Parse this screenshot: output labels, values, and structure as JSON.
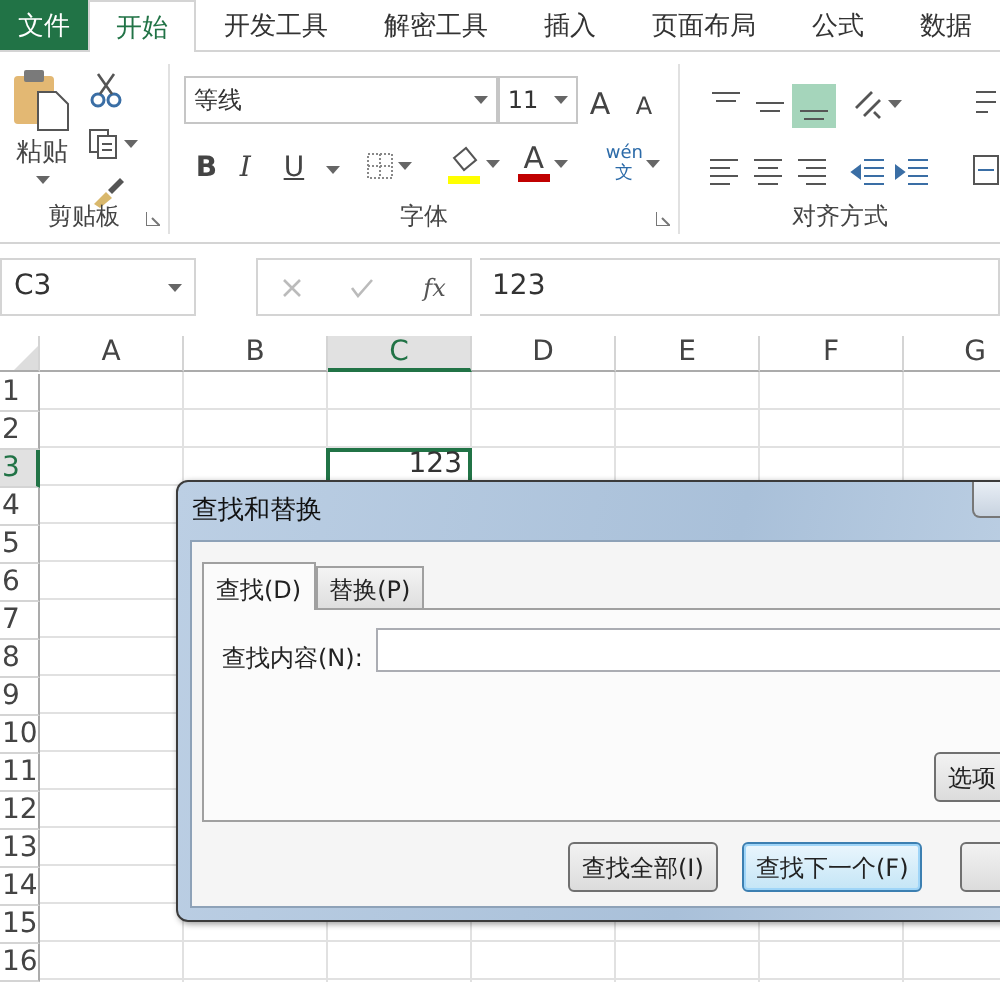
{
  "ribbon_tabs": [
    {
      "label": "文件",
      "kind": "file",
      "selected": false
    },
    {
      "label": "开始",
      "kind": "tab",
      "selected": true
    },
    {
      "label": "开发工具",
      "kind": "tab",
      "selected": false
    },
    {
      "label": "解密工具",
      "kind": "tab",
      "selected": false
    },
    {
      "label": "插入",
      "kind": "tab",
      "selected": false
    },
    {
      "label": "页面布局",
      "kind": "tab",
      "selected": false
    },
    {
      "label": "公式",
      "kind": "tab",
      "selected": false
    },
    {
      "label": "数据",
      "kind": "tab",
      "selected": false
    }
  ],
  "clipboard": {
    "paste": "粘贴",
    "group_label": "剪贴板"
  },
  "font": {
    "name": "等线",
    "size": "11",
    "grow": "A",
    "shrink": "A",
    "bold": "B",
    "italic": "I",
    "underline": "U",
    "font_color": "A",
    "phonetic_top": "wén",
    "phonetic_bottom": "文",
    "group_label": "字体"
  },
  "alignment": {
    "vertical": [
      {
        "selected": false
      },
      {
        "selected": false
      },
      {
        "selected": true
      }
    ],
    "group_label": "对齐方式"
  },
  "formula_bar": {
    "name_box": "C3",
    "fx": "fx",
    "formula": "123"
  },
  "sheet": {
    "columns": [
      {
        "label": "A",
        "selected": false
      },
      {
        "label": "B",
        "selected": false
      },
      {
        "label": "C",
        "selected": true
      },
      {
        "label": "D",
        "selected": false
      },
      {
        "label": "E",
        "selected": false
      },
      {
        "label": "F",
        "selected": false
      },
      {
        "label": "G",
        "selected": false
      }
    ],
    "rows": [
      {
        "label": "1",
        "selected": false
      },
      {
        "label": "2",
        "selected": false
      },
      {
        "label": "3",
        "selected": true
      },
      {
        "label": "4",
        "selected": false
      },
      {
        "label": "5",
        "selected": false
      },
      {
        "label": "6",
        "selected": false
      },
      {
        "label": "7",
        "selected": false
      },
      {
        "label": "8",
        "selected": false
      },
      {
        "label": "9",
        "selected": false
      },
      {
        "label": "10",
        "selected": false
      },
      {
        "label": "11",
        "selected": false
      },
      {
        "label": "12",
        "selected": false
      },
      {
        "label": "13",
        "selected": false
      },
      {
        "label": "14",
        "selected": false
      },
      {
        "label": "15",
        "selected": false
      },
      {
        "label": "16",
        "selected": false
      }
    ],
    "active_value": "123"
  },
  "dialog": {
    "title": "查找和替换",
    "tabs": [
      {
        "label": "查找(D)",
        "selected": true
      },
      {
        "label": "替换(P)",
        "selected": false
      }
    ],
    "find_label": "查找内容(N):",
    "options_button": "选项",
    "buttons": [
      {
        "label": "查找全部(I)",
        "focused": false
      },
      {
        "label": "查找下一个(F)",
        "focused": true
      }
    ]
  }
}
